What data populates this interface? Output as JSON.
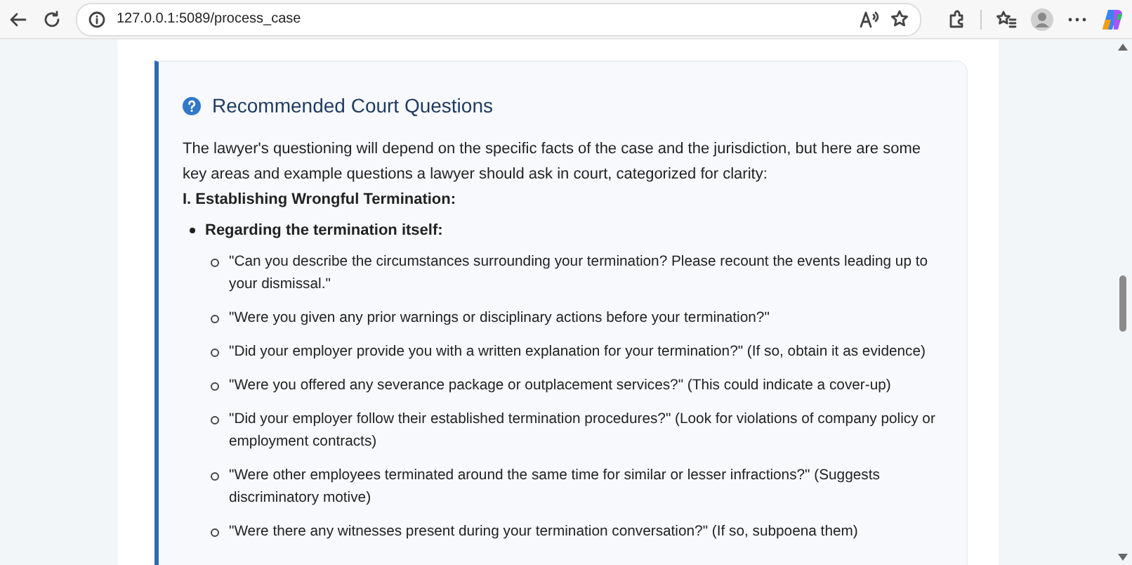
{
  "browser": {
    "url": "127.0.0.1:5089/process_case"
  },
  "section": {
    "title": "Recommended Court Questions",
    "intro": "The lawyer's questioning will depend on the specific facts of the case and the jurisdiction, but here are some key areas and example questions a lawyer should ask in court, categorized for clarity:",
    "heading": "I. Establishing Wrongful Termination:",
    "groups": [
      {
        "label": "Regarding the termination itself:",
        "questions": [
          "\"Can you describe the circumstances surrounding your termination? Please recount the events leading up to your dismissal.\"",
          "\"Were you given any prior warnings or disciplinary actions before your termination?\"",
          "\"Did your employer provide you with a written explanation for your termination?\" (If so, obtain it as evidence)",
          "\"Were you offered any severance package or outplacement services?\" (This could indicate a cover-up)",
          "\"Did your employer follow their established termination procedures?\" (Look for violations of company policy or employment contracts)",
          "\"Were other employees terminated around the same time for similar or lesser infractions?\" (Suggests discriminatory motive)",
          "\"Were there any witnesses present during your termination conversation?\" (If so, subpoena them)"
        ]
      }
    ]
  }
}
